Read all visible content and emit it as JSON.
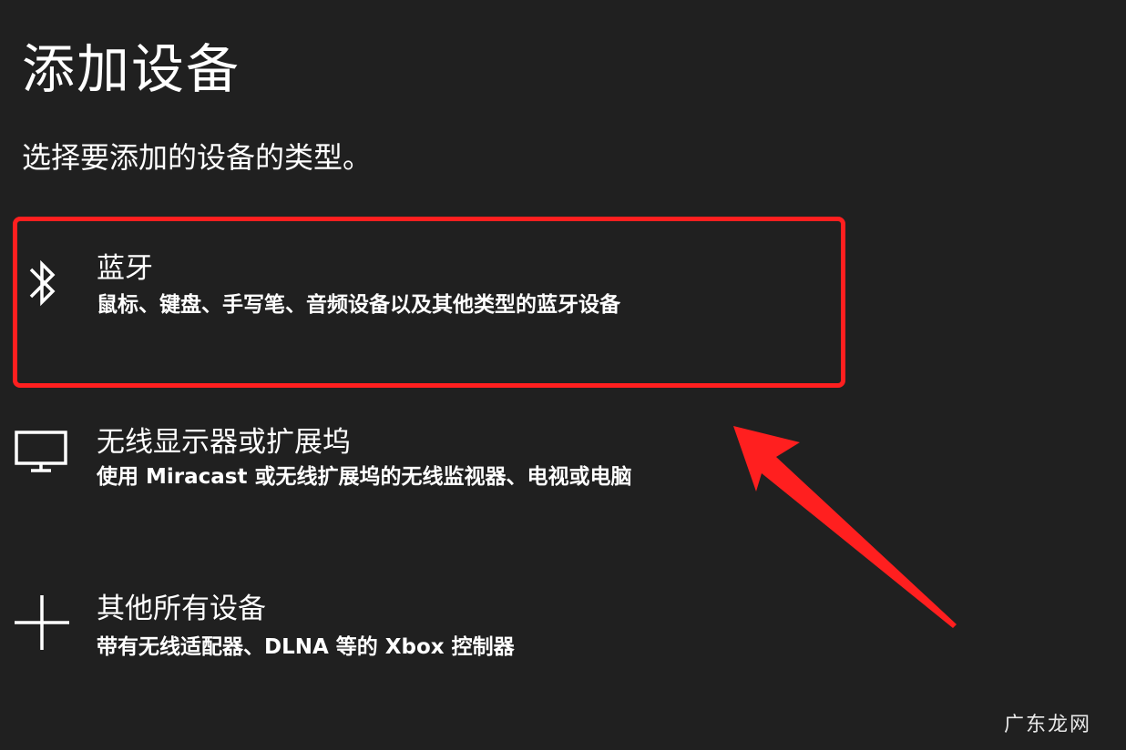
{
  "title": "添加设备",
  "subtitle": "选择要添加的设备的类型。",
  "options": [
    {
      "icon": "bluetooth-icon",
      "label": "蓝牙",
      "description": "鼠标、键盘、手写笔、音频设备以及其他类型的蓝牙设备",
      "highlighted": true
    },
    {
      "icon": "monitor-icon",
      "label": "无线显示器或扩展坞",
      "description": "使用 Miracast 或无线扩展坞的无线监视器、电视或电脑"
    },
    {
      "icon": "plus-icon",
      "label": "其他所有设备",
      "description": "带有无线适配器、DLNA 等的 Xbox 控制器"
    }
  ],
  "colors": {
    "background": "#202020",
    "text": "#ffffff",
    "annotation": "#ff1f1f"
  },
  "watermark": "广东龙网"
}
